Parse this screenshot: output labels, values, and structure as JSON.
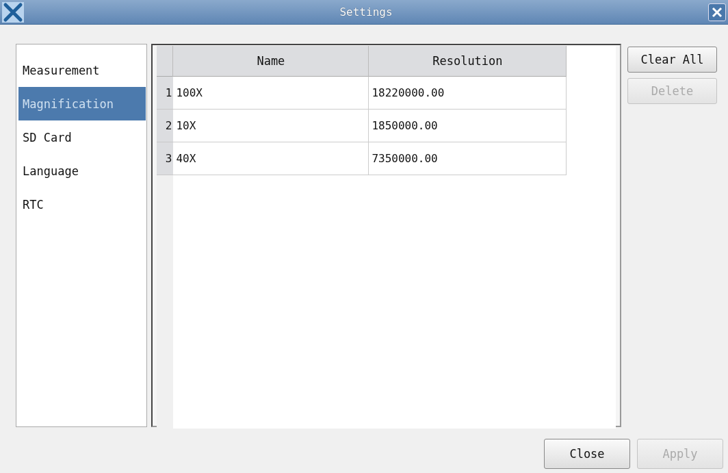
{
  "window": {
    "title": "Settings"
  },
  "sidebar": {
    "items": [
      {
        "label": "Measurement",
        "selected": false
      },
      {
        "label": "Magnification",
        "selected": true
      },
      {
        "label": "SD Card",
        "selected": false
      },
      {
        "label": "Language",
        "selected": false
      },
      {
        "label": "RTC",
        "selected": false
      }
    ]
  },
  "table": {
    "columns": [
      "Name",
      "Resolution"
    ],
    "rows": [
      {
        "index": "1",
        "cells": [
          "100X",
          "18220000.00"
        ]
      },
      {
        "index": "2",
        "cells": [
          "10X",
          "1850000.00"
        ]
      },
      {
        "index": "3",
        "cells": [
          "40X",
          "7350000.00"
        ]
      }
    ]
  },
  "side_buttons": [
    {
      "label": "Clear All",
      "disabled": false
    },
    {
      "label": "Delete",
      "disabled": true
    }
  ],
  "footer_buttons": [
    {
      "label": "Close",
      "disabled": false
    },
    {
      "label": "Apply",
      "disabled": true
    }
  ]
}
